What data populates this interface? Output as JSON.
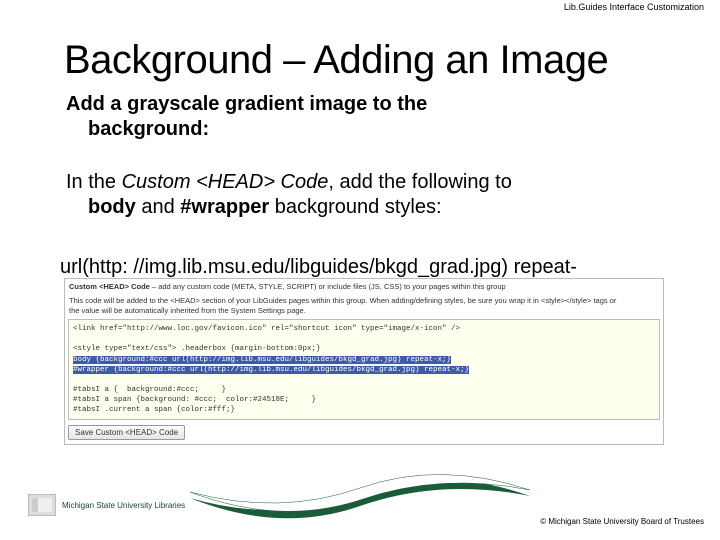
{
  "header": {
    "label": "Lib.Guides Interface Customization"
  },
  "title": "Background – Adding an Image",
  "subtitle": {
    "line1": "Add a grayscale gradient image to the",
    "line2": "background:"
  },
  "instruction": {
    "prefix": "In the ",
    "em": "Custom <HEAD> Code",
    "mid": ", add the following to ",
    "b1": "body",
    "and": " and ",
    "b2": "#wrapper",
    "suffix": " background styles:"
  },
  "snippet": "url(http: //img.lib.msu.edu/libguides/bkgd_grad.jpg) repeat-",
  "panel": {
    "title_bold": "Custom <HEAD> Code",
    "title_rest": " – add any custom code (META, STYLE, SCRIPT) or include files (JS, CSS) to your pages within this group",
    "help1": "This code will be added to the <HEAD> section of your LibGuides pages within this group. When adding/defining styles, be sure you wrap it in <style></style> tags or",
    "help2": "the value will be automatically inherited from the System Settings page.",
    "code": {
      "l1": "<link href=\"http://www.loc.gov/favicon.ico\" rel=\"shortcut icon\" type=\"image/x-icon\" />",
      "l2": "<style type=\"text/css\"> .headerbox {margin-bottom:0px;}",
      "l3a": "body {background:#ccc url(http://img.lib.msu.edu/libguides/bkgd_grad.jpg) repeat-x;}",
      "l3b": "#wrapper {background:#ccc url(http://img.lib.msu.edu/libguides/bkgd_grad.jpg) repeat-x;}",
      "l4": "#tabsI a {  background:#ccc;     }",
      "l5": "#tabsI a span {background: #ccc;  color:#24518E;     }",
      "l6": "#tabsI .current a span {color:#fff;}"
    },
    "button": "Save Custom <HEAD> Code"
  },
  "footer": {
    "org": "Michigan State University Libraries",
    "copyright": "© Michigan State University Board of Trustees"
  }
}
